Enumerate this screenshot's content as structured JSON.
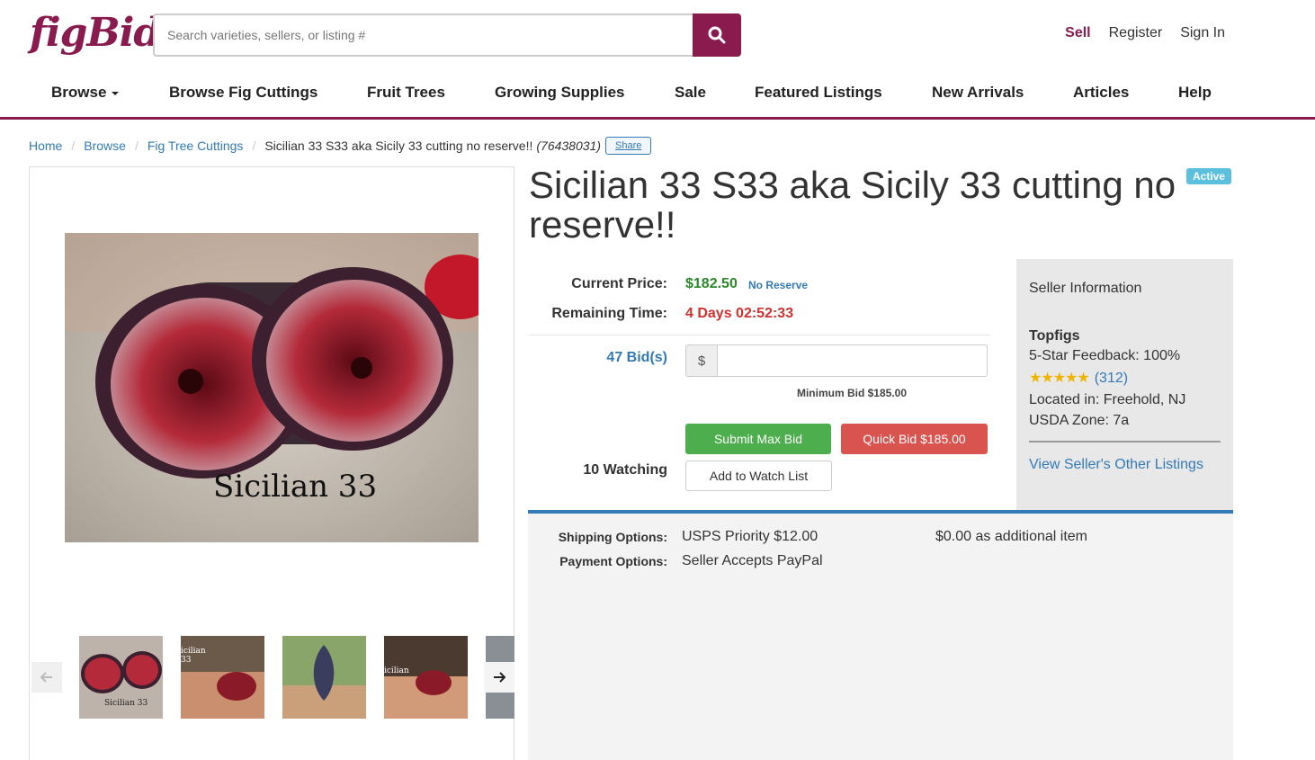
{
  "header": {
    "logo": "figBid",
    "search_placeholder": "Search varieties, sellers, or listing #",
    "links": {
      "sell": "Sell",
      "register": "Register",
      "sign_in": "Sign In"
    }
  },
  "nav": {
    "items": [
      "Browse",
      "Browse Fig Cuttings",
      "Fruit Trees",
      "Growing Supplies",
      "Sale",
      "Featured Listings",
      "New Arrivals",
      "Articles",
      "Help"
    ]
  },
  "breadcrumb": {
    "items": [
      "Home",
      "Browse",
      "Fig Tree Cuttings"
    ],
    "current": "Sicilian 33 S33 aka Sicily 33 cutting no reserve!!",
    "listing_id": "(76438031)",
    "share": "Share"
  },
  "listing": {
    "title": "Sicilian 33 S33 aka Sicily 33 cutting no reserve!!",
    "status": "Active",
    "image_caption": "Sicilian 33",
    "thumbnail_captions": [
      "Sicilian 33",
      "icilian 33",
      "",
      "icilian"
    ]
  },
  "bid": {
    "current_price_label": "Current Price:",
    "current_price": "$182.50",
    "reserve": "No Reserve",
    "remaining_label": "Remaining Time:",
    "remaining": "4 Days 02:52:33",
    "bids": "47 Bid(s)",
    "currency": "$",
    "minimum_bid": "Minimum Bid $185.00",
    "submit": "Submit Max Bid",
    "quick_bid": "Quick Bid $185.00",
    "watching": "10 Watching",
    "watch_list": "Add to Watch List"
  },
  "seller": {
    "heading": "Seller Information",
    "name": "Topfigs",
    "feedback": "5-Star Feedback: 100%",
    "rating_stars": 5,
    "rating_count": "(312)",
    "location": "Located in: Freehold, NJ",
    "zone": "USDA Zone: 7a",
    "other_listings": "View Seller's Other Listings"
  },
  "shipping": {
    "shipping_label": "Shipping Options:",
    "shipping_value": "USPS Priority $12.00",
    "additional": "$0.00 as additional item",
    "payment_label": "Payment Options:",
    "payment_value": "Seller Accepts PayPal"
  },
  "colors": {
    "brand": "#8a1b4f",
    "link": "#337ab7",
    "price_green": "#2a8a2a",
    "alert_red": "#d32f2f",
    "active_badge": "#5bc0de"
  }
}
